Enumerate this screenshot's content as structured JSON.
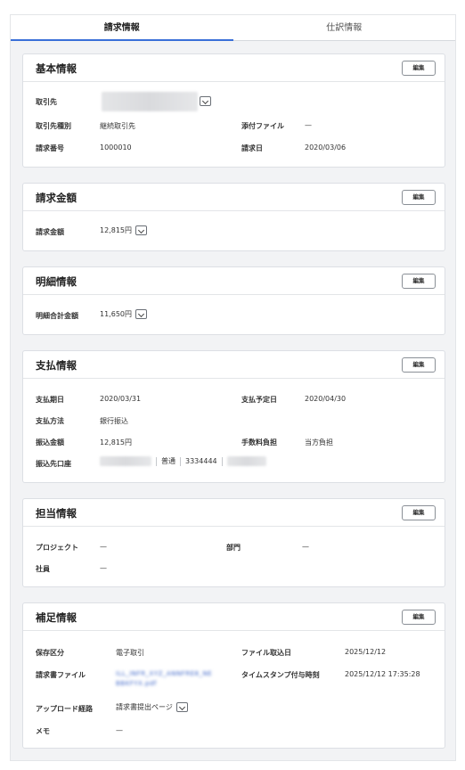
{
  "tabs": [
    {
      "label": "請求情報",
      "active": true
    },
    {
      "label": "仕訳情報",
      "active": false
    }
  ],
  "edit_label": "編集",
  "basic": {
    "title": "基本情報",
    "partner_label": "取引先",
    "partner_type_label": "取引先種別",
    "partner_type_value": "継続取引先",
    "attachment_label": "添付ファイル",
    "attachment_value": "—",
    "invoice_no_label": "請求番号",
    "invoice_no_value": "1000010",
    "invoice_date_label": "請求日",
    "invoice_date_value": "2020/03/06"
  },
  "amount": {
    "title": "請求金額",
    "label": "請求金額",
    "value": "12,815円"
  },
  "detail": {
    "title": "明細情報",
    "label": "明細合計金額",
    "value": "11,650円"
  },
  "payment": {
    "title": "支払情報",
    "due_label": "支払期日",
    "due_value": "2020/03/31",
    "planned_label": "支払予定日",
    "planned_value": "2020/04/30",
    "method_label": "支払方法",
    "method_value": "銀行振込",
    "transfer_label": "振込金額",
    "transfer_value": "12,815円",
    "fee_label": "手数料負担",
    "fee_value": "当方負担",
    "account_label": "振込先口座",
    "account_type": "普通",
    "account_no": "3334444"
  },
  "owner": {
    "title": "担当情報",
    "project_label": "プロジェクト",
    "project_value": "—",
    "dept_label": "部門",
    "dept_value": "—",
    "employee_label": "社員",
    "employee_value": "—"
  },
  "supplement": {
    "title": "補足情報",
    "storage_label": "保存区分",
    "storage_value": "電子取引",
    "import_date_label": "ファイル取込日",
    "import_date_value": "2025/12/12",
    "file_label": "請求書ファイル",
    "file_name_line1": "ILL_INFR_XYZ_ANNFRE8_NE",
    "file_name_line2": "BBKFYX.pdf",
    "timestamp_label": "タイムスタンプ付与時刻",
    "timestamp_value": "2025/12/12 17:35:28",
    "upload_label": "アップロード経路",
    "upload_value": "請求書提出ページ",
    "memo_label": "メモ",
    "memo_value": "—"
  }
}
